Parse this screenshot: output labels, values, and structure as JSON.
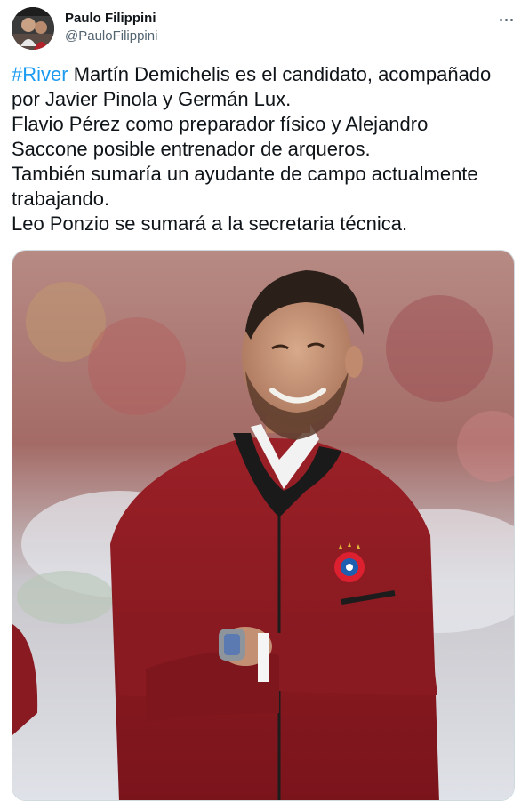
{
  "author": {
    "display_name": "Paulo Filippini",
    "handle": "@PauloFilippini"
  },
  "icons": {
    "more": "more-horizontal-icon"
  },
  "tweet": {
    "hashtag": "#River",
    "line1_rest": " Martín Demichelis es el candidato, acompañado",
    "lines": [
      "por Javier Pinola y Germán Lux.",
      "Flavio Pérez como preparador físico y Alejandro",
      "Saccone posible entrenador de arqueros.",
      "También sumaría un ayudante de campo actualmente",
      "trabajando.",
      "Leo Ponzio se sumará a la secretaria técnica."
    ]
  },
  "colors": {
    "hashtag": "#1d9bf0",
    "handle": "#536471",
    "text": "#0f1419",
    "jacket": "#8e1c22"
  }
}
